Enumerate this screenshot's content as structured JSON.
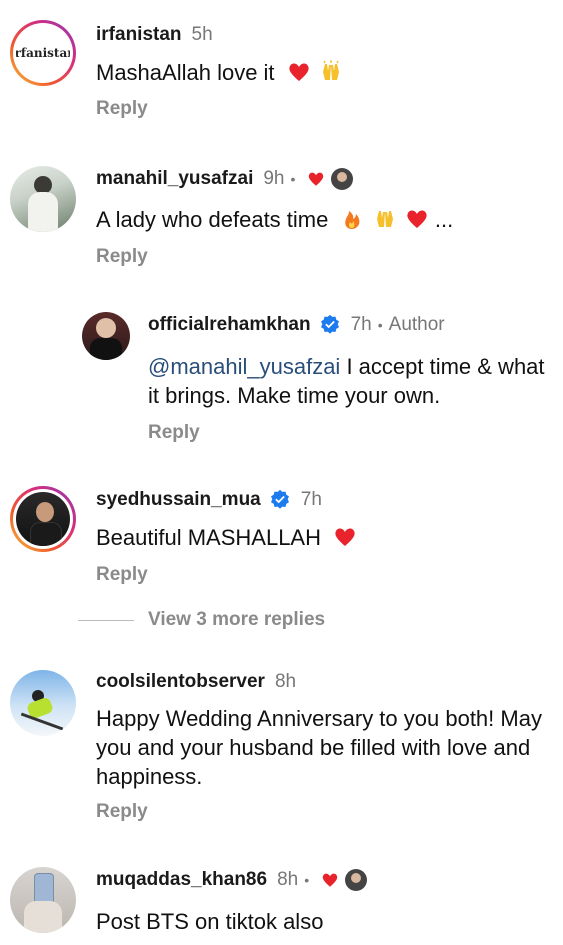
{
  "comments": [
    {
      "username": "irfanistan",
      "time": "5h",
      "text": "MashaAllah love it",
      "reply": "Reply",
      "avatar_text": "irfanistan"
    },
    {
      "username": "manahil_yusafzai",
      "time": "9h",
      "text": "A lady who defeats time",
      "text_suffix": "...",
      "reply": "Reply"
    },
    {
      "username": "officialrehamkhan",
      "time": "7h",
      "author_label": "Author",
      "mention": "@manahil_yusafzai",
      "text": " I accept time & what it brings. Make time your own.",
      "reply": "Reply"
    },
    {
      "username": "syedhussain_mua",
      "time": "7h",
      "text": "Beautiful MASHALLAH",
      "reply": "Reply"
    },
    {
      "username": "coolsilentobserver",
      "time": "8h",
      "text": "Happy Wedding Anniversary to you both! May you and your husband be filled with love and happiness.",
      "reply": "Reply"
    },
    {
      "username": "muqaddas_khan86",
      "time": "8h",
      "text": "Post BTS on tiktok also"
    }
  ],
  "view_more_replies": "View 3 more replies",
  "colors": {
    "heart": "#e8232b",
    "verified": "#1d7bf0",
    "mention": "#2a4e7a",
    "muted": "#8a8a8a"
  }
}
